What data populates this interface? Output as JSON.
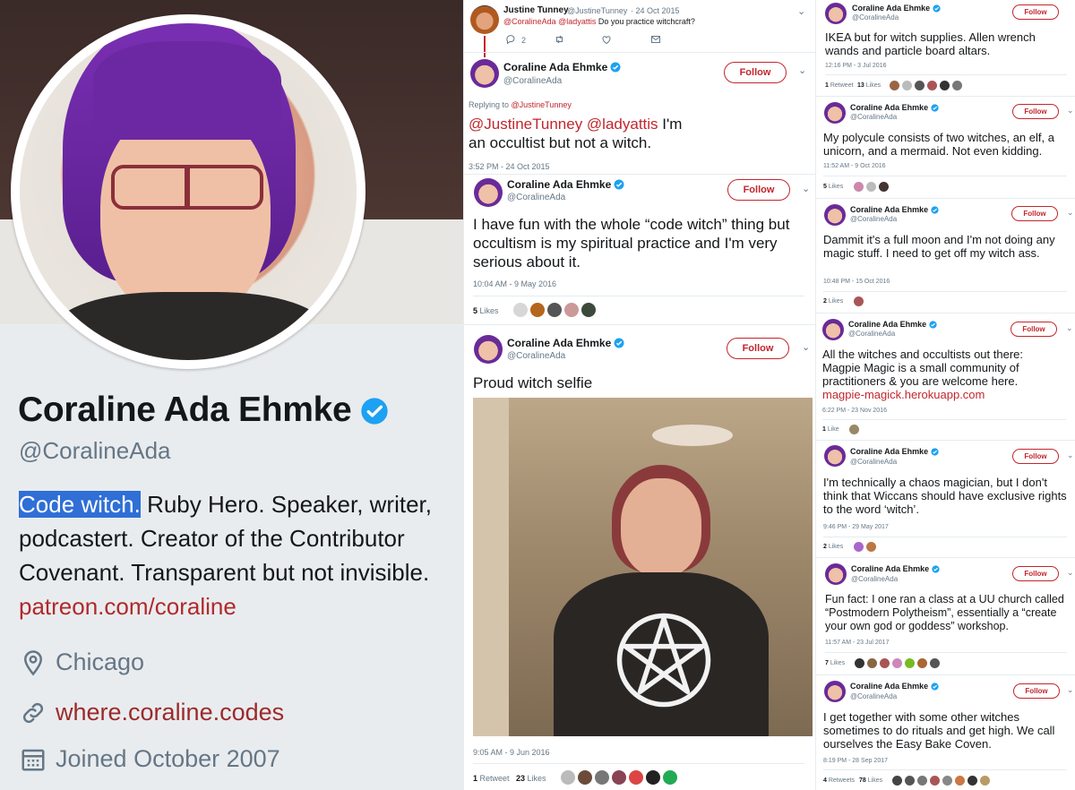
{
  "profile": {
    "name": "Coraline Ada Ehmke",
    "handle": "@CoralineAda",
    "bio_highlight": "Code witch.",
    "bio_rest": " Ruby Hero. Speaker, writer, podcastert. Creator of the Contributor Covenant. Transparent but not invisible.",
    "bio_link": "patreon.com/coraline",
    "location": "Chicago",
    "website": "where.coraline.codes",
    "joined": "Joined October 2007"
  },
  "middle": {
    "t1": {
      "name": "Justine Tunney",
      "handle": "@JustineTunney",
      "date": "· 24 Oct 2015",
      "mention": "@CoralineAda @ladyattis",
      "text": " Do you practice witchcraft?",
      "replies": "2"
    },
    "t2": {
      "name": "Coraline Ada Ehmke",
      "handle": "@CoralineAda",
      "follow": "Follow",
      "replying_prefix": "Replying to ",
      "replying_to": "@JustineTunney",
      "mention": "@JustineTunney @ladyattis",
      "text": " I'm an occultist but not a witch.",
      "time": "3:52 PM - 24 Oct 2015"
    },
    "t3": {
      "name": "Coraline Ada Ehmke",
      "handle": "@CoralineAda",
      "follow": "Follow",
      "text": "I have fun with the whole “code witch” thing but occultism is my spiritual practice and I'm very serious about it.",
      "time": "10:04 AM - 9 May 2016",
      "likes_n": "5",
      "likes_l": " Likes"
    },
    "t4": {
      "name": "Coraline Ada Ehmke",
      "handle": "@CoralineAda",
      "follow": "Follow",
      "text": "Proud witch selfie",
      "time": "9:05 AM - 9 Jun 2016",
      "retweets_n": "1",
      "retweets_l": " Retweet",
      "likes_n": "23",
      "likes_l": " Likes"
    }
  },
  "right": {
    "r1": {
      "name": "Coraline Ada Ehmke",
      "handle": "@CoralineAda",
      "follow": "Follow",
      "text": "IKEA but for witch supplies. Allen wrench wands and particle board altars.",
      "time": "12:16 PM - 3 Jul 2016",
      "retweets_n": "1",
      "retweets_l": " Retweet",
      "likes_n": "13",
      "likes_l": " Likes"
    },
    "r2": {
      "name": "Coraline Ada Ehmke",
      "handle": "@CoralineAda",
      "follow": "Follow",
      "text": "My polycule consists of two witches, an elf, a unicorn, and a mermaid. Not even kidding.",
      "time": "11:52 AM - 9 Oct 2016",
      "likes_n": "5",
      "likes_l": " Likes"
    },
    "r3": {
      "name": "Coraline Ada Ehmke",
      "handle": "@CoralineAda",
      "follow": "Follow",
      "text": "Dammit it's a full moon and I'm not doing any magic stuff. I need to get off my witch ass.",
      "time": "10:48 PM - 15 Oct 2016",
      "likes_n": "2",
      "likes_l": " Likes"
    },
    "r4": {
      "name": "Coraline Ada Ehmke",
      "handle": "@CoralineAda",
      "follow": "Follow",
      "text": "All the witches and occultists out there: Magpie Magic is a small community of practitioners & you are welcome here.",
      "link": "magpie-magick.herokuapp.com",
      "time": "6:22 PM - 23 Nov 2016",
      "likes_n": "1",
      "likes_l": " Like"
    },
    "r5": {
      "name": "Coraline Ada Ehmke",
      "handle": "@CoralineAda",
      "follow": "Follow",
      "text": "I'm technically a chaos magician, but I don't think that Wiccans should have exclusive rights to the word ‘witch’.",
      "time": "9:46 PM - 29 May 2017",
      "likes_n": "2",
      "likes_l": " Likes"
    },
    "r6": {
      "name": "Coraline Ada Ehmke",
      "handle": "@CoralineAda",
      "follow": "Follow",
      "text": "Fun fact: I one ran a class at a UU church called “Postmodern Polytheism”, essentially a “create your own god or goddess” workshop.",
      "time": "11:57 AM - 23 Jul 2017",
      "likes_n": "7",
      "likes_l": " Likes"
    },
    "r7": {
      "name": "Coraline Ada Ehmke",
      "handle": "@CoralineAda",
      "follow": "Follow",
      "text": "I get together with some other witches sometimes to do rituals and get high. We call ourselves the Easy Bake Coven.",
      "time": "8:19 PM - 28 Sep 2017",
      "retweets_n": "4",
      "retweets_l": " Retweets",
      "likes_n": "78",
      "likes_l": " Likes"
    }
  },
  "colors": {
    "accent": "#c2262d",
    "verified": "#1da1f2",
    "highlight": "#2f6fd6"
  },
  "icons": [
    "verified-badge-icon",
    "location-pin-icon",
    "link-icon",
    "calendar-icon",
    "reply-icon",
    "retweet-icon",
    "like-icon",
    "message-icon",
    "chevron-down-icon"
  ]
}
